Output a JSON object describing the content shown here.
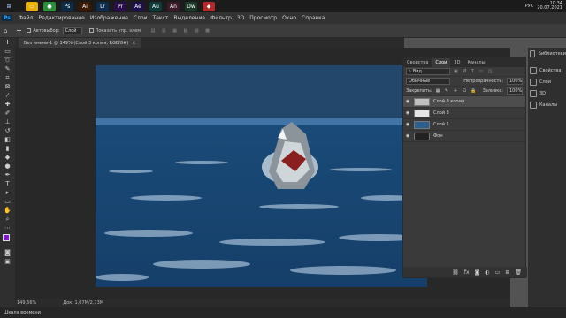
{
  "taskbar": {
    "apps": [
      {
        "name": "explorer-icon",
        "glyph": "▭",
        "color": "#e8b000"
      },
      {
        "name": "chrome-icon",
        "glyph": "●",
        "color": "#2a8f3d"
      },
      {
        "name": "ps-icon",
        "glyph": "Ps",
        "color": "#0d2b47"
      },
      {
        "name": "ai-icon",
        "glyph": "Ai",
        "color": "#3a1a05"
      },
      {
        "name": "lr-icon",
        "glyph": "Lr",
        "color": "#0e2d4e"
      },
      {
        "name": "pr-icon",
        "glyph": "Pr",
        "color": "#2a0e4b"
      },
      {
        "name": "ae-icon",
        "glyph": "Ae",
        "color": "#1d0f4b"
      },
      {
        "name": "au-icon",
        "glyph": "Au",
        "color": "#0c3b3a"
      },
      {
        "name": "an-icon",
        "glyph": "An",
        "color": "#3b1a2a"
      },
      {
        "name": "dw-icon",
        "glyph": "Dw",
        "color": "#1c3a2a"
      },
      {
        "name": "app-icon",
        "glyph": "◆",
        "color": "#b22b2b"
      }
    ],
    "lang": "РУС",
    "time": "10:34",
    "date": "20.07.2021"
  },
  "menu": [
    "Файл",
    "Редактирование",
    "Изображение",
    "Слои",
    "Текст",
    "Выделение",
    "Фильтр",
    "3D",
    "Просмотр",
    "Окно",
    "Справка"
  ],
  "options": {
    "move_label": "Автовыбор:",
    "layer_select": "Слой",
    "transform_label": "Показать упр. элем."
  },
  "doc": {
    "tab_title": "Без имени-1 @ 149% (Слой 3 копия, RGB/8#)",
    "zoom": "149,66%",
    "doc_size": "Док: 1,07М/2,73М"
  },
  "panel": {
    "tabs": [
      "Свойства",
      "Слои",
      "3D",
      "Каналы"
    ],
    "active_tab": "Слои",
    "search": "Вид",
    "blend_mode": "Обычные",
    "opacity_label": "Непрозрачность:",
    "opacity": "100%",
    "lock_label": "Закрепить:",
    "fill_label": "Заливка:",
    "fill": "100%",
    "layers": [
      {
        "name": "Слой 3 копия",
        "selected": true,
        "thumb": "#bfbfbf"
      },
      {
        "name": "Слой 3",
        "selected": false,
        "thumb": "#e5e5e5"
      },
      {
        "name": "Слой 1",
        "selected": false,
        "thumb": "#2b5f8d"
      },
      {
        "name": "Фон",
        "selected": false,
        "thumb": "#222222"
      }
    ]
  },
  "dock": {
    "top": "Библиотеки",
    "items": [
      "Свойства",
      "Слои",
      "3D",
      "Каналы"
    ]
  },
  "bottom": {
    "label": "Шкала времени"
  }
}
